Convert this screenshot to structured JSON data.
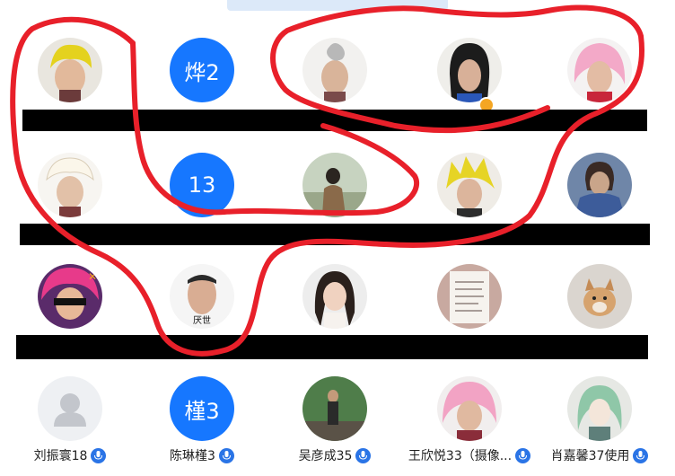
{
  "grid": {
    "rows": [
      [
        {
          "type": "photo",
          "icon": "person-yellow-hair-avatar-icon"
        },
        {
          "type": "initial",
          "initial": "烨2"
        },
        {
          "type": "photo",
          "icon": "person-apple-logo-avatar-icon"
        },
        {
          "type": "photo",
          "icon": "person-black-hair-avatar-icon",
          "badge": true
        },
        {
          "type": "photo",
          "icon": "person-pink-hair-avatar-icon"
        }
      ],
      [
        {
          "type": "photo",
          "icon": "person-white-hat-avatar-icon"
        },
        {
          "type": "initial",
          "initial": "13"
        },
        {
          "type": "photo",
          "icon": "person-outdoor-woman-avatar-icon"
        },
        {
          "type": "photo",
          "icon": "person-yellow-spiky-hair-avatar-icon"
        },
        {
          "type": "photo",
          "icon": "armored-warrior-avatar-icon"
        }
      ],
      [
        {
          "type": "photo",
          "icon": "sunglasses-cartoon-avatar-icon"
        },
        {
          "type": "photo",
          "icon": "person-meme-face-avatar-icon",
          "label": "厌世"
        },
        {
          "type": "photo",
          "icon": "woman-braids-avatar-icon"
        },
        {
          "type": "photo",
          "icon": "handwritten-paper-avatar-icon"
        },
        {
          "type": "photo",
          "icon": "dog-avatar-icon"
        }
      ],
      [
        {
          "type": "placeholder",
          "icon": "default-user-avatar-icon",
          "name": "刘振寰18"
        },
        {
          "type": "initial",
          "initial": "槿3",
          "name": "陈琳槿3"
        },
        {
          "type": "photo",
          "icon": "person-outdoor-garden-avatar-icon",
          "name": "吴彦成35"
        },
        {
          "type": "photo",
          "icon": "person-pink-wig-avatar-icon",
          "name": "王欣悦33（摄像..."
        },
        {
          "type": "photo",
          "icon": "anime-girl-green-hair-avatar-icon",
          "name": "肖嘉馨37使用"
        }
      ]
    ]
  },
  "colors": {
    "accent": "#1677ff",
    "redact": "#000000",
    "scribble": "#e8202a",
    "mic": "#2a74e6"
  }
}
